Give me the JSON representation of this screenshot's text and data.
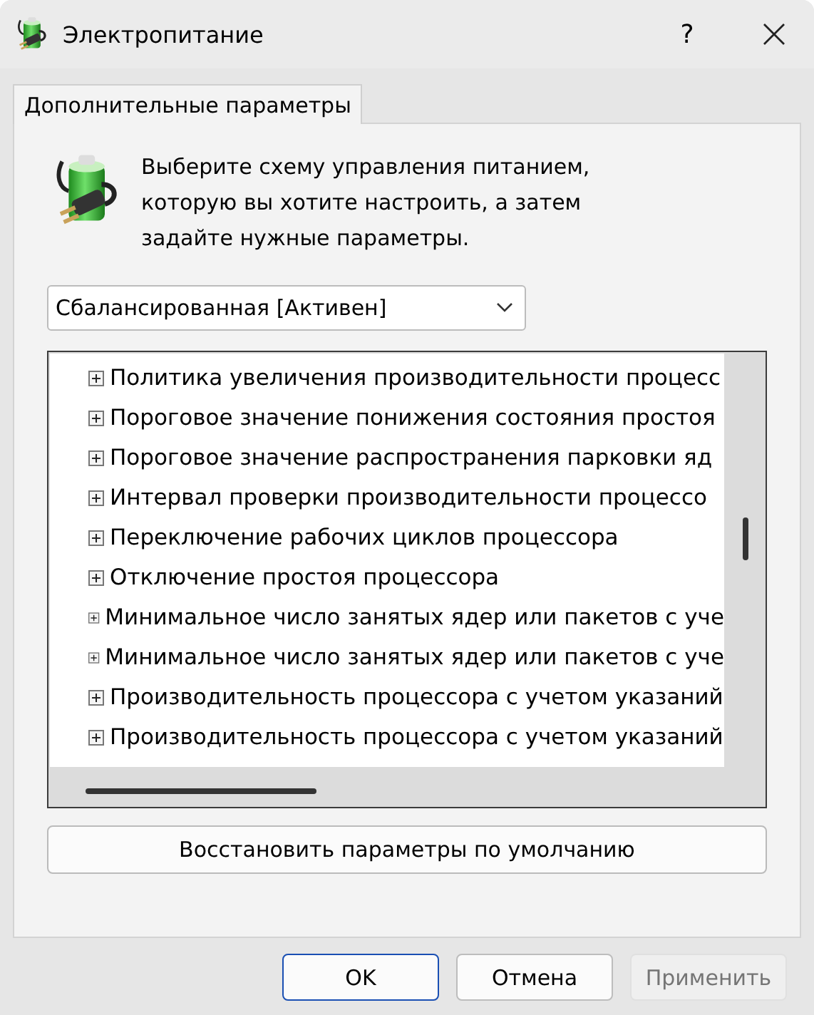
{
  "window": {
    "title": "Электропитание",
    "help": "?"
  },
  "tabs": [
    {
      "label": "Дополнительные параметры",
      "selected": true
    }
  ],
  "description": "Выберите схему управления питанием, которую вы хотите настроить, а затем задайте нужные параметры.",
  "scheme": {
    "value": "Сбалансированная [Активен]"
  },
  "tree": {
    "items": [
      {
        "label": "Политика увеличения производительности процесс",
        "expanded": false
      },
      {
        "label": "Пороговое значение понижения состояния простоя",
        "expanded": false
      },
      {
        "label": "Пороговое значение распространения парковки яд",
        "expanded": false
      },
      {
        "label": "Интервал проверки производительности процессо",
        "expanded": false
      },
      {
        "label": "Переключение рабочих циклов процессора",
        "expanded": false
      },
      {
        "label": "Отключение простоя процессора",
        "expanded": false
      },
      {
        "label": "Минимальное число занятых ядер или пакетов с уче",
        "expanded": false
      },
      {
        "label": "Минимальное число занятых ядер или пакетов с уче",
        "expanded": false
      },
      {
        "label": "Производительность процессора с учетом указаний",
        "expanded": false
      },
      {
        "label": "Производительность процессора с учетом указаний",
        "expanded": false
      }
    ]
  },
  "restore_button": "Восстановить параметры по умолчанию",
  "buttons": [
    {
      "label": "OK",
      "default": true,
      "disabled": false
    },
    {
      "label": "Отмена",
      "default": false,
      "disabled": false
    },
    {
      "label": "Применить",
      "default": false,
      "disabled": true
    }
  ]
}
